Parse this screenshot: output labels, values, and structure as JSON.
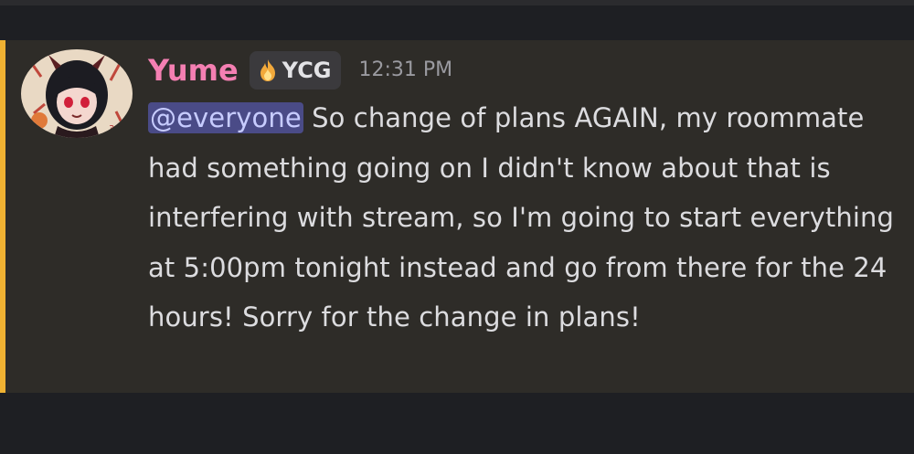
{
  "message": {
    "author": "Yume",
    "clan_tag": "YCG",
    "timestamp": "12:31 PM",
    "mention": "@everyone",
    "text": " So change of plans AGAIN, my roommate had something going on I didn't know about that is interfering with stream, so I'm going to start everything at 5:00pm tonight instead and go from there for the 24 hours! Sorry for the change in plans!",
    "avatar_icon": "anime-girl-avatar-icon",
    "clan_badge_icon": "flame-badge-icon"
  },
  "colors": {
    "username": "#f47fb2",
    "highlight_bar": "#f0b232",
    "mention_bg": "#4a4b87"
  }
}
